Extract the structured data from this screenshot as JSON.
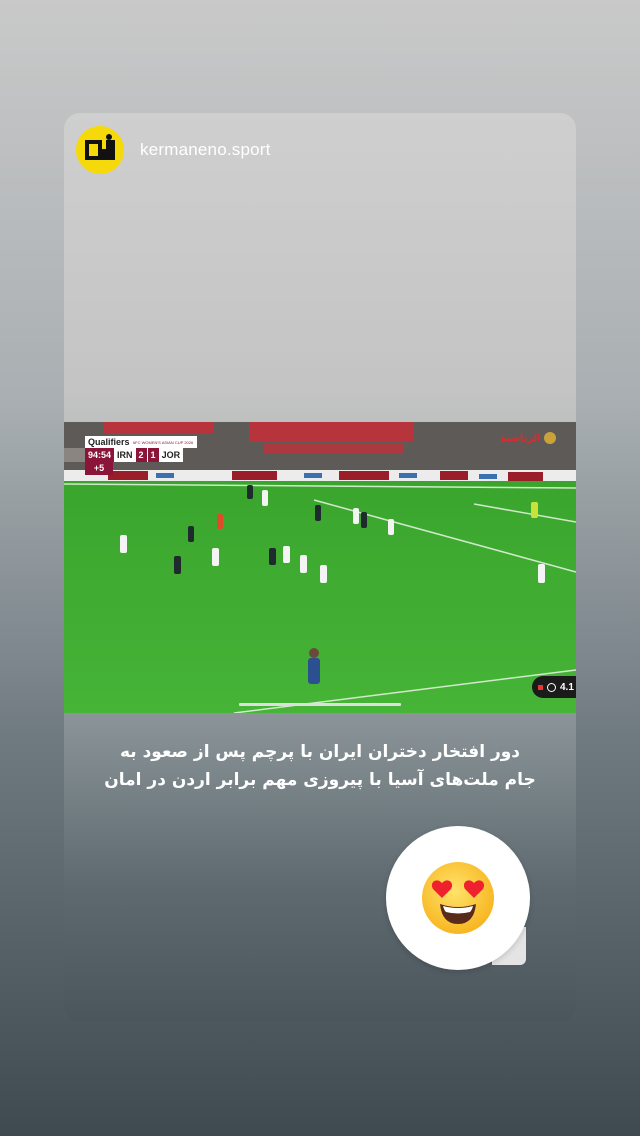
{
  "story": {
    "username": "kermaneno.sport",
    "avatar_text": "نو",
    "caption_line1": "دور افتخار دختران ایران با پرچم پس از صعود به",
    "caption_line2": "جام ملت‌های آسیا با پیروزی مهم برابر اردن در امان",
    "reaction_emoji": "heart-eyes-emoji"
  },
  "video": {
    "scoreboard": {
      "stage": "Qualifiers",
      "competition": "AFC WOMEN'S ASIAN CUP 2026",
      "clock": "94:54",
      "home_team": "IRN",
      "home_score": "2",
      "away_score": "1",
      "away_team": "JOR",
      "added_time": "+5"
    },
    "channel_logo": "الرياضية",
    "viewer_count": "4.1"
  },
  "colors": {
    "avatar_yellow": "#f5d90a",
    "pitch_green": "#3fa832",
    "scoreboard_maroon": "#8a1538"
  }
}
